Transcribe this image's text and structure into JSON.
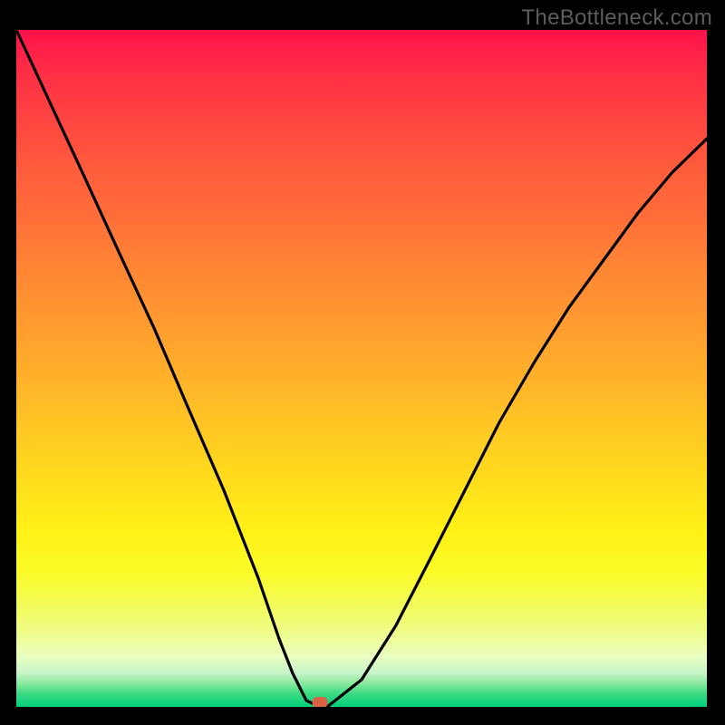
{
  "watermark": "TheBottleneck.com",
  "chart_data": {
    "type": "line",
    "title": "",
    "xlabel": "",
    "ylabel": "",
    "xlim": [
      0,
      100
    ],
    "ylim": [
      0,
      100
    ],
    "series": [
      {
        "name": "curve",
        "x": [
          0,
          5,
          10,
          15,
          20,
          25,
          30,
          35,
          38,
          40,
          42,
          44,
          45,
          50,
          55,
          60,
          65,
          70,
          75,
          80,
          85,
          90,
          95,
          100
        ],
        "values": [
          100,
          89,
          78,
          67,
          56,
          44,
          32,
          19,
          10,
          5,
          1,
          0,
          0,
          4,
          12,
          22,
          32,
          42,
          51,
          59,
          66,
          73,
          79,
          84
        ]
      }
    ],
    "marker": {
      "x": 44,
      "y": 0.6
    },
    "background_gradient": {
      "top": "#ff124a",
      "mid": "#fff116",
      "bottom": "#00cf7c"
    },
    "curve_color": "#000000",
    "marker_color": "#db6244"
  }
}
